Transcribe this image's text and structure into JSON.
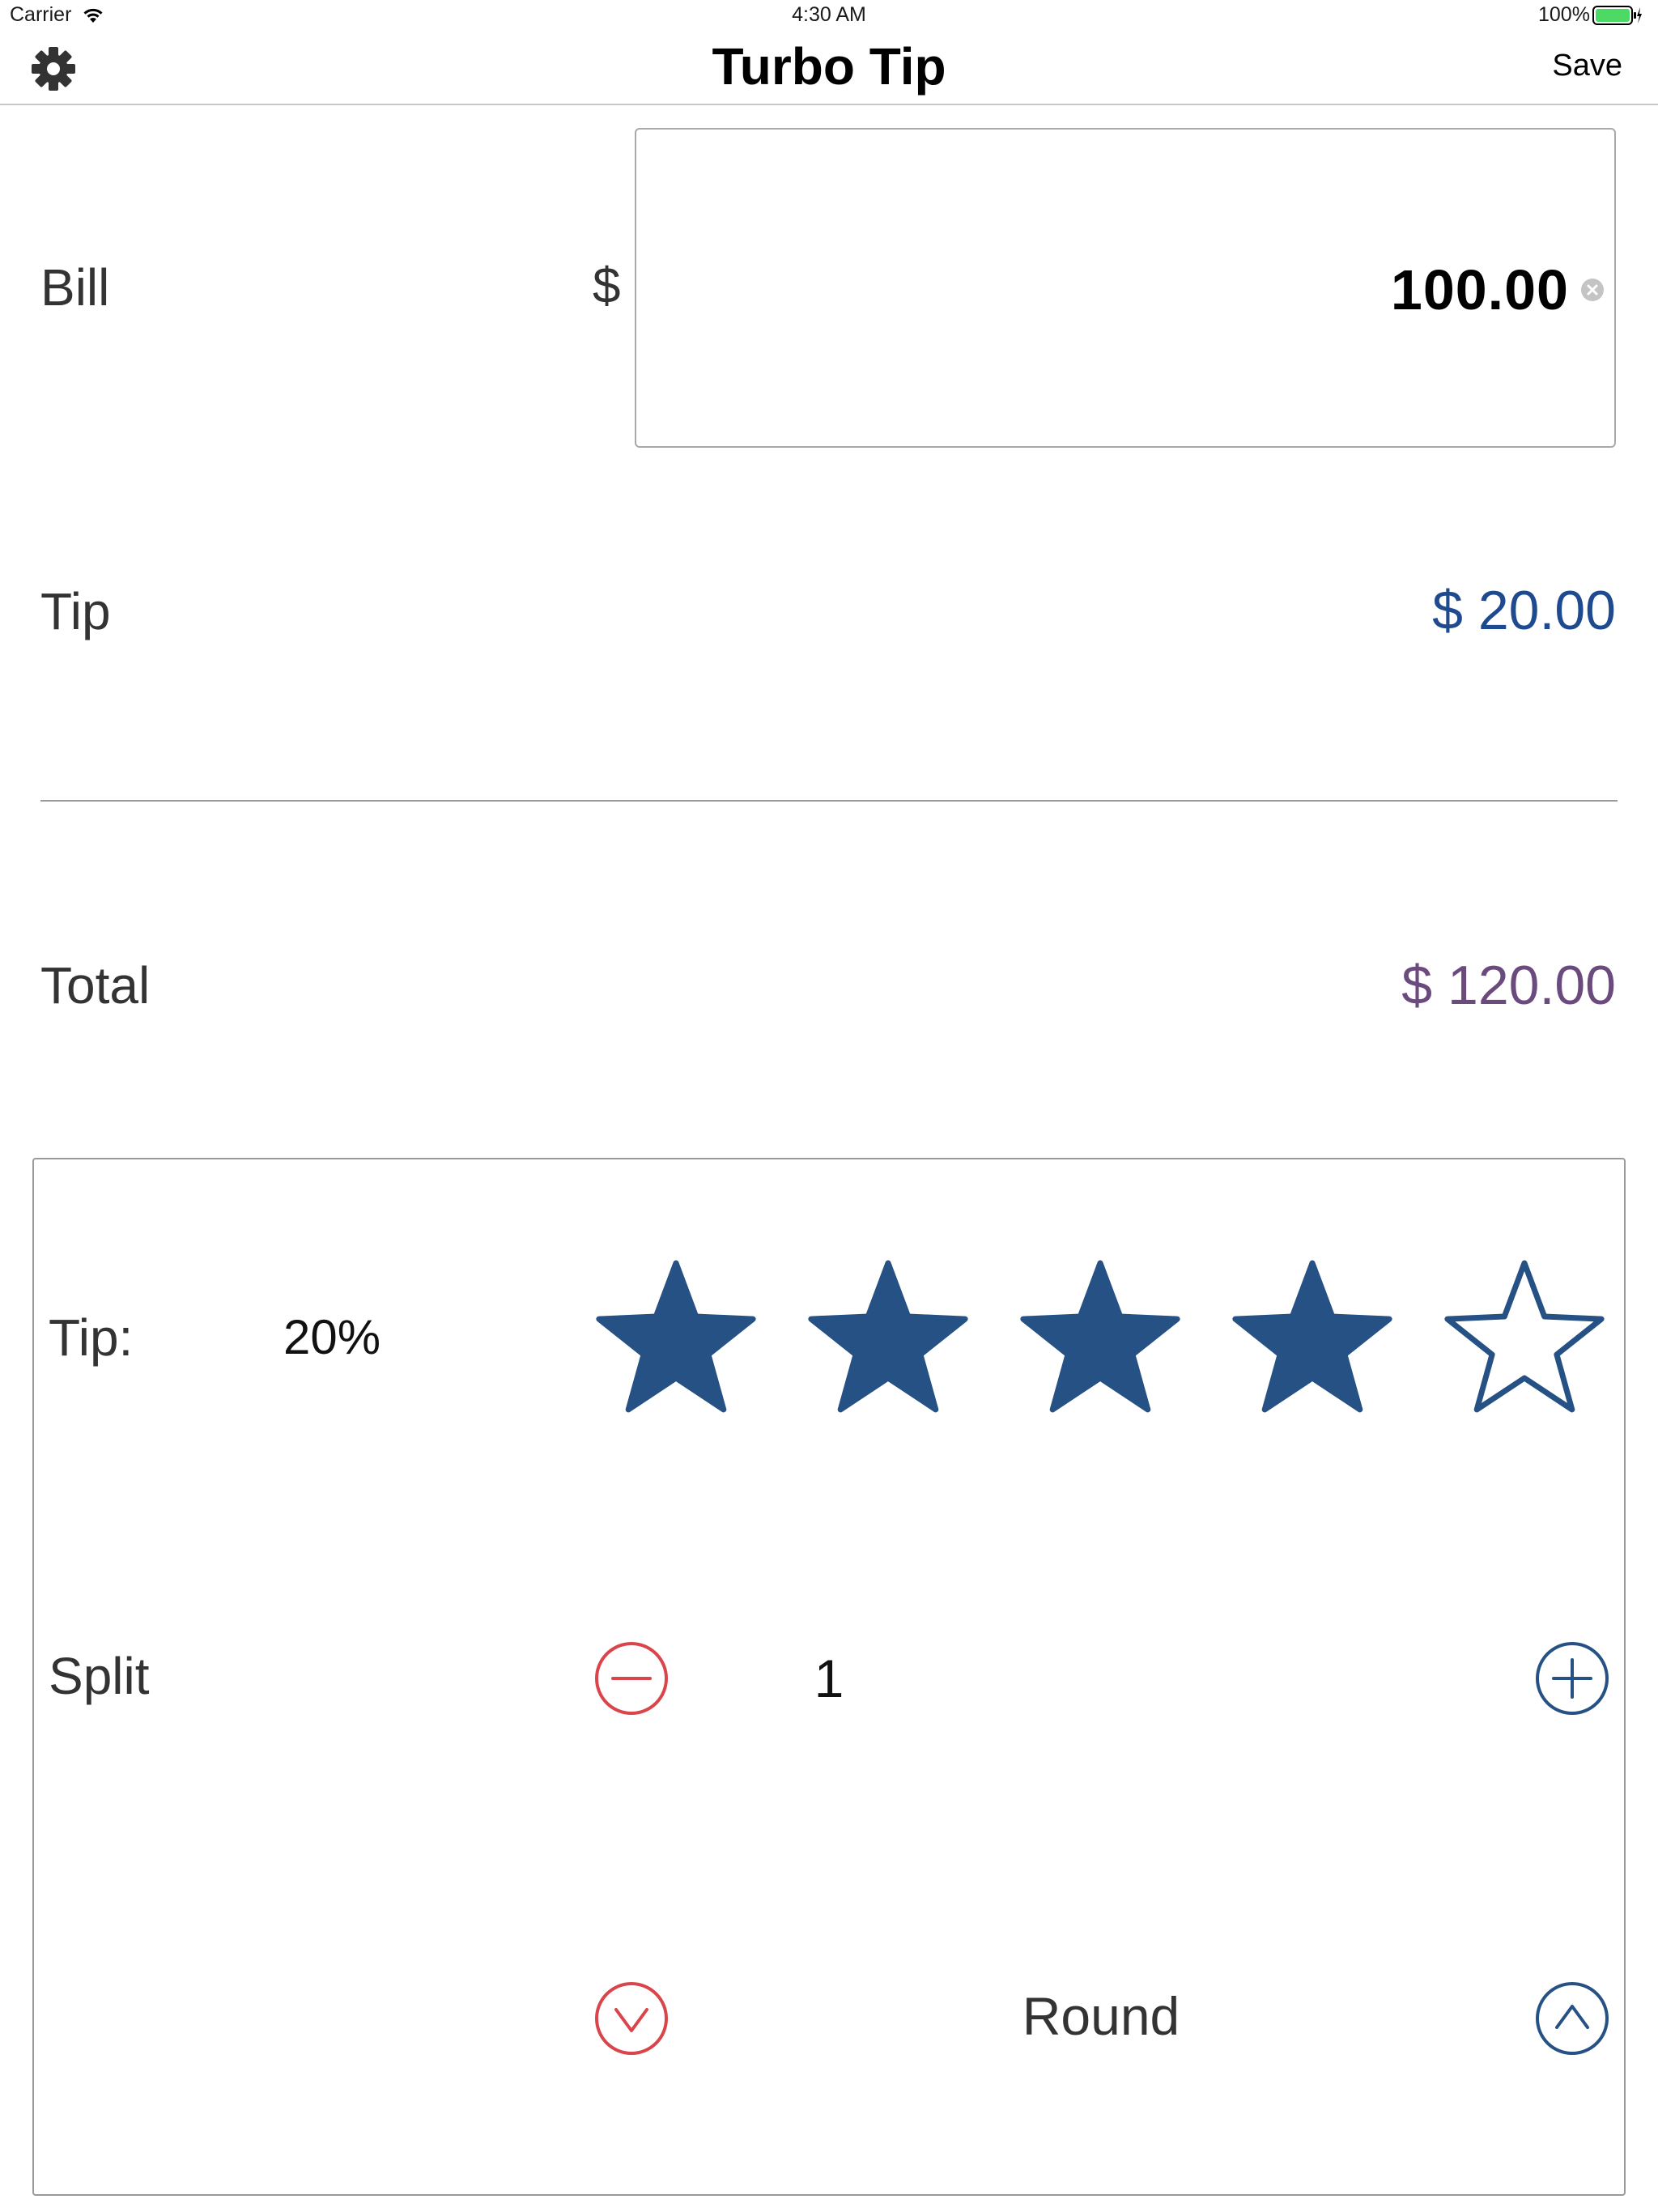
{
  "status_bar": {
    "carrier": "Carrier",
    "time": "4:30 AM",
    "battery": "100%"
  },
  "nav": {
    "title": "Turbo Tip",
    "save_label": "Save",
    "settings_icon": "gear-icon"
  },
  "bill": {
    "label": "Bill",
    "currency": "$",
    "value": "100.00",
    "clear_icon": "clear-icon"
  },
  "tip": {
    "label": "Tip",
    "amount": "$ 20.00"
  },
  "total": {
    "label": "Total",
    "amount": "$ 120.00"
  },
  "controls": {
    "tip_label": "Tip:",
    "tip_percent": "20%",
    "rating": {
      "value": 4,
      "max": 5
    },
    "split_label": "Split",
    "split_count": "1",
    "round_label": "Round"
  },
  "colors": {
    "star": "#265184",
    "tip_amount": "#1e4b8f",
    "total_amount": "#6b4a7e",
    "minus_red": "#d9454a",
    "plus_blue": "#265184",
    "battery_green": "#4cd964"
  }
}
